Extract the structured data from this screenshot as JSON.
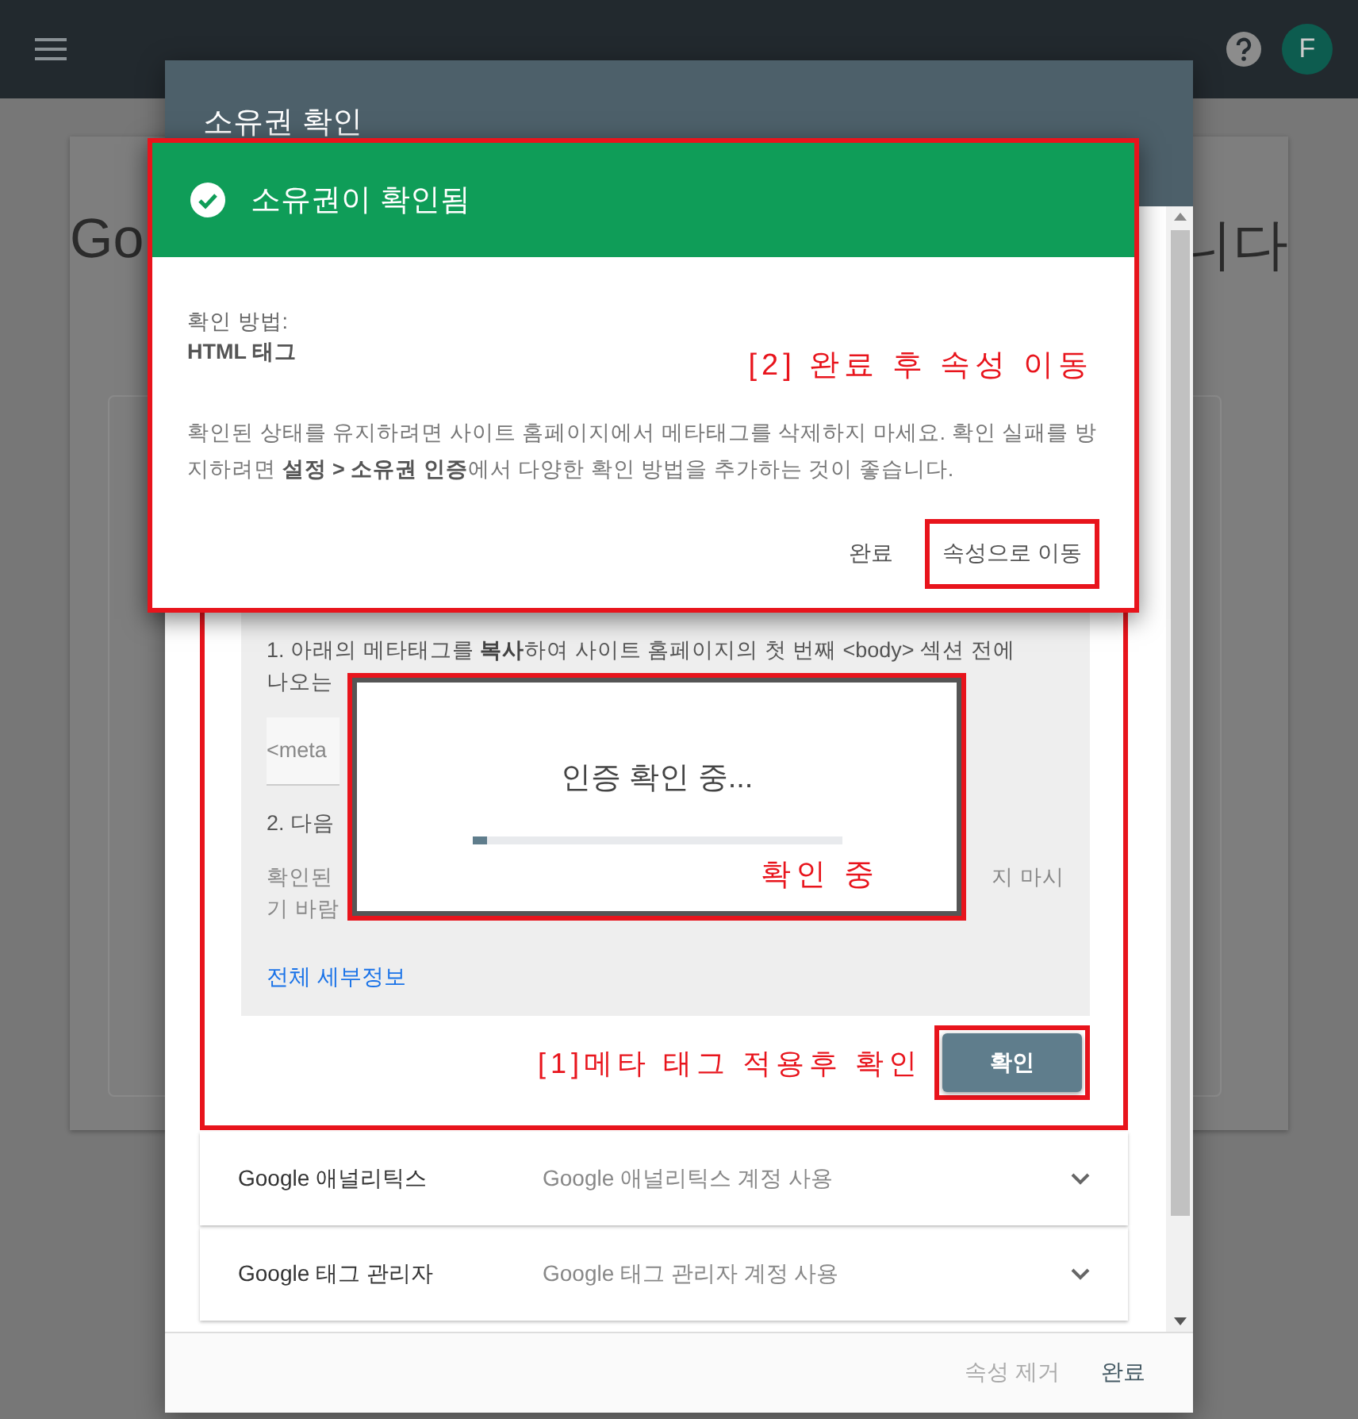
{
  "top_bar": {
    "avatar_letter": "F"
  },
  "background_page": {
    "heading_left": "Go",
    "heading_right": "니다"
  },
  "dialog": {
    "title": "소유권 확인",
    "html_tag_method": {
      "instruction_1": "1. 아래의 메타태그를 **복사**하여 사이트 홈페이지의 첫 번째 <body> 섹션 전에",
      "instruction_1_continued": "나오는",
      "code_field_value": "<meta",
      "instruction_2": "2. 다음",
      "note_left": "확인된",
      "note_right": "지 마시",
      "note_continued": "기 바람",
      "details_link": "전체 세부정보",
      "verify_button": "확인",
      "annotation": "[1]메타 태그 적용후 확인"
    },
    "other_methods": [
      {
        "name": "Google 애널리틱스",
        "description": "Google 애널리틱스 계정 사용",
        "expanded": false
      },
      {
        "name": "Google 태그 관리자",
        "description": "Google 태그 관리자 계정 사용",
        "expanded": false
      }
    ],
    "footer_buttons": [
      {
        "label": "속성 제거",
        "disabled": true
      },
      {
        "label": "완료",
        "disabled": false
      }
    ]
  },
  "success_dialog": {
    "title": "소유권이 확인됨",
    "method_label": "확인 방법:",
    "method_value": "HTML 태그",
    "annotation": "[2] 완료 후 속성 이동",
    "message": "확인된 상태를 유지하려면 사이트 홈페이지에서 메타태그를 삭제하지 마세요. 확인 실패를 방지하려면 **설정 > 소유권 인증**에서 다양한 확인 방법을 추가하는 것이 좋습니다.",
    "buttons": [
      "완료",
      "속성으로 이동"
    ]
  },
  "progress_dialog": {
    "message": "인증 확인 중...",
    "level": 0.04,
    "annotation": "확인 중"
  }
}
